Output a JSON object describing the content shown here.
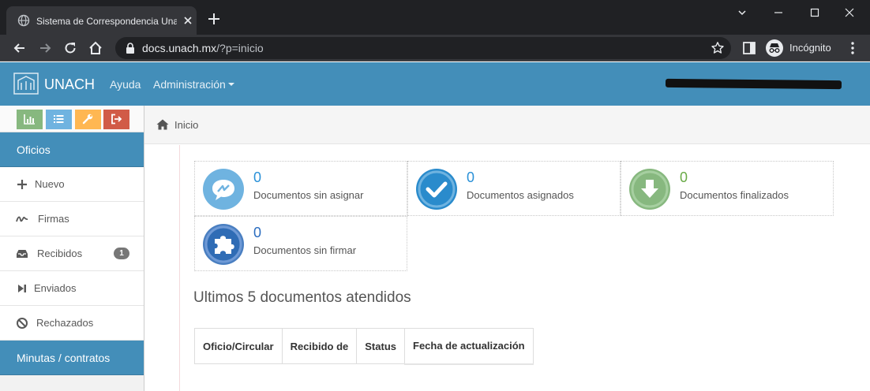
{
  "browser": {
    "tab_title": "Sistema de Correspondencia Unach",
    "url_host": "docs.unach.mx",
    "url_path": "/?p=inicio",
    "profile_label": "Incógnito",
    "colors": {
      "frame": "#202124",
      "toolbar": "#35363a"
    }
  },
  "navbar": {
    "brand": "UNACH",
    "links": [
      {
        "label": "Ayuda"
      },
      {
        "label": "Administración"
      }
    ],
    "color": "#438eb9"
  },
  "sidebar": {
    "shortcuts": [
      {
        "icon": "bar-chart-icon",
        "color": "#87b87f"
      },
      {
        "icon": "list-icon",
        "color": "#6fb3e0"
      },
      {
        "icon": "wrench-icon",
        "color": "#ffb752"
      },
      {
        "icon": "sign-out-icon",
        "color": "#d15b47"
      }
    ],
    "sections": [
      {
        "title": "Oficios"
      },
      {
        "title": "Minutas / contratos"
      }
    ],
    "items": [
      {
        "label": "Nuevo",
        "icon": "plus-icon"
      },
      {
        "label": "Firmas",
        "icon": "signature-icon"
      },
      {
        "label": "Recibidos",
        "icon": "inbox-icon",
        "badge": "1"
      },
      {
        "label": "Enviados",
        "icon": "step-forward-icon"
      },
      {
        "label": "Rechazados",
        "icon": "ban-icon"
      }
    ]
  },
  "breadcrumb": {
    "label": "Inicio",
    "icon": "home-icon"
  },
  "stats": [
    {
      "count": "0",
      "label": "Documentos sin asignar",
      "icon": "comments-icon",
      "color": "#6fb3e0",
      "number_color": "#2a91d8"
    },
    {
      "count": "0",
      "label": "Documentos asignados",
      "icon": "check-icon",
      "color": "#2a8bcc",
      "number_color": "#2a91d8"
    },
    {
      "count": "0",
      "label": "Documentos finalizados",
      "icon": "download-icon",
      "color": "#87b87f",
      "number_color": "#69aa46"
    },
    {
      "count": "0",
      "label": "Documentos sin firmar",
      "icon": "puzzle-icon",
      "color": "#4a7fc1",
      "number_color": "#2a6cbf"
    }
  ],
  "recent": {
    "title": "Ultimos 5 documentos atendidos",
    "columns": [
      "Oficio/Circular",
      "Recibido de",
      "Status",
      "Fecha de actualización"
    ]
  }
}
